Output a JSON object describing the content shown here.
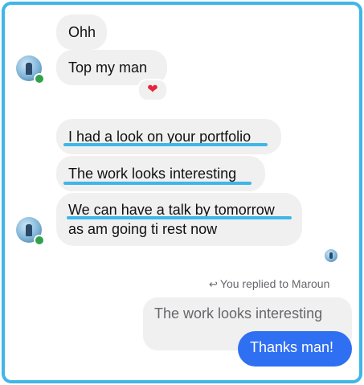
{
  "conversation": {
    "incoming_group1": [
      {
        "text": "Ohh"
      },
      {
        "text": "Top my man",
        "reaction": "❤"
      }
    ],
    "incoming_group2": [
      {
        "text": "I had a look on your portfolio"
      },
      {
        "text": "The work looks interesting"
      },
      {
        "line1": "We can have a talk by tomorrow",
        "line2": "as am going ti rest now"
      }
    ],
    "reply": {
      "note_icon": "reply-arrow-icon",
      "note": "You replied to Maroun",
      "quoted": "The work looks interesting",
      "message": "Thanks man!"
    }
  },
  "colors": {
    "frame_border": "#3fb6e8",
    "underline_highlight": "#3fb6e8",
    "incoming_bubble": "#f0f0f0",
    "outgoing_bubble": "#2f6ff2",
    "online_dot": "#31a24c",
    "reaction_heart": "#e8233c"
  }
}
